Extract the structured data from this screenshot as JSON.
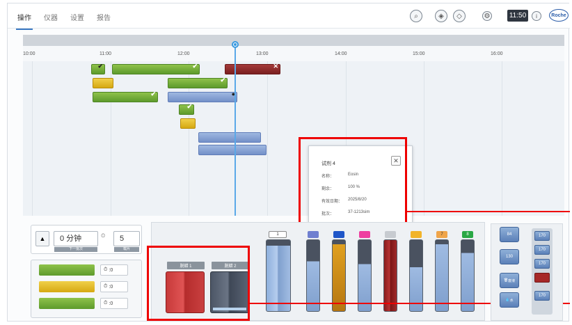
{
  "tabs": [
    {
      "label": "操作",
      "active": true
    },
    {
      "label": "仪器"
    },
    {
      "label": "设置"
    },
    {
      "label": "报告"
    }
  ],
  "header": {
    "clock": "11:50",
    "logo": "Roche",
    "icons": [
      "search-icon",
      "slide-icon",
      "shield-icon",
      "gear-icon",
      "info-icon"
    ]
  },
  "timeline": {
    "times": [
      "10:00",
      "11:00",
      "12:00",
      "13:00",
      "14:00",
      "15:00",
      "16:00"
    ]
  },
  "popup": {
    "title": "试剂 4",
    "close": "✕",
    "rows": [
      {
        "label": "名称：",
        "value": "Eosin"
      },
      {
        "label": "剩余：",
        "value": "100 %"
      },
      {
        "label": "有效日期：",
        "value": "2025/8/20"
      },
      {
        "label": "批次：",
        "value": "37-1213sim"
      }
    ]
  },
  "controls": {
    "eject": "▲",
    "time_value": "0 分钟",
    "time_sub": "下一批次",
    "count_value": "5",
    "count_sub": "载片",
    "reagents": [
      {
        "color": "green",
        "timer": ":0"
      },
      {
        "color": "yellow",
        "timer": ":0"
      },
      {
        "color": "green",
        "timer": ":0"
      }
    ]
  },
  "baths": [
    {
      "label": "脱蜡 1",
      "color": "red"
    },
    {
      "label": "脱蜡 2",
      "color": "dark"
    }
  ],
  "vials": [
    {
      "label": "1",
      "cap": "#ffffff"
    },
    {
      "label": "",
      "cap": "#6f7fd0"
    },
    {
      "label": "",
      "cap": "#1f56c8"
    },
    {
      "label": "",
      "cap": "#ee3fa0"
    },
    {
      "label": "",
      "cap": "#c7cbd0"
    },
    {
      "label": "",
      "cap": "#f2b42a"
    },
    {
      "label": "7",
      "cap": "#f0a54a"
    },
    {
      "label": "8",
      "cap": "#2aa845"
    }
  ],
  "right_panel": {
    "tiles": [
      "84",
      "130",
      "废液",
      "水"
    ],
    "stack": [
      "170",
      "170",
      "170",
      "",
      "170"
    ]
  },
  "colors": {
    "accent": "#3a78c2",
    "highlight": "#ee0000"
  }
}
